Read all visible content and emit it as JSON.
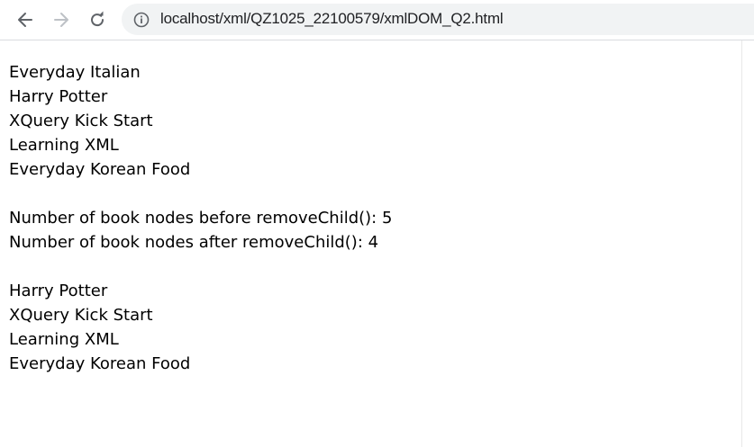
{
  "browser": {
    "url": "localhost/xml/QZ1025_22100579/xmlDOM_Q2.html",
    "icons": {
      "back": "arrow-left-icon",
      "forward": "arrow-right-icon",
      "reload": "reload-icon",
      "info": "info-icon"
    }
  },
  "page": {
    "list_before": [
      "Everyday Italian",
      "Harry Potter",
      "XQuery Kick Start",
      "Learning XML",
      "Everyday Korean Food"
    ],
    "count_before": "Number of book nodes before removeChild(): 5",
    "count_after": "Number of book nodes after removeChild(): 4",
    "list_after": [
      "Harry Potter",
      "XQuery Kick Start",
      "Learning XML",
      "Everyday Korean Food"
    ]
  }
}
